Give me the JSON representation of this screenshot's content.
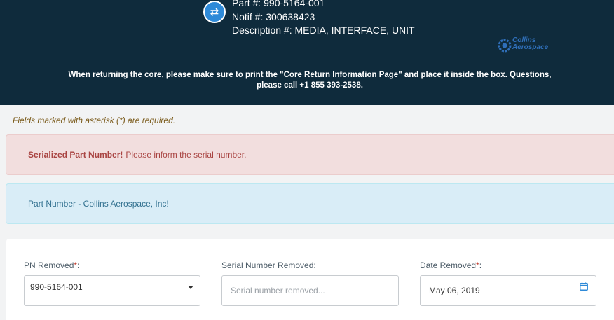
{
  "header": {
    "part_line": "Part #: 990-5164-001",
    "notif_line": "Notif #: 300638423",
    "description_line": "Description #: MEDIA, INTERFACE, UNIT",
    "swap_icon": "swap-icon",
    "logo": {
      "line1": "Collins",
      "line2": "Aerospace"
    },
    "notice": "When returning the core, please make sure to print the \"Core Return Information Page\" and place it inside the box. Questions, please call +1 855 393-2538."
  },
  "required_note": "Fields marked with asterisk (*) are required.",
  "alerts": {
    "danger": {
      "title": "Serialized Part Number!",
      "message": "Please inform the serial number."
    },
    "info": {
      "message": "Part Number - Collins Aerospace, Inc!"
    }
  },
  "form": {
    "pn_removed": {
      "label": "PN Removed",
      "required_mark": "*",
      "suffix": ":",
      "value": "990-5164-001"
    },
    "serial_removed": {
      "label": "Serial Number Removed:",
      "placeholder": "Serial number removed..."
    },
    "date_removed": {
      "label": "Date Removed",
      "required_mark": "*",
      "suffix": ":",
      "value": "May 06, 2019",
      "icon": "calendar-icon"
    }
  },
  "colors": {
    "header_bg": "#0f2b3c",
    "accent": "#2e8ad8",
    "danger_bg": "#f2dede",
    "info_bg": "#d9edf7",
    "logo": "#2f6fb9"
  }
}
